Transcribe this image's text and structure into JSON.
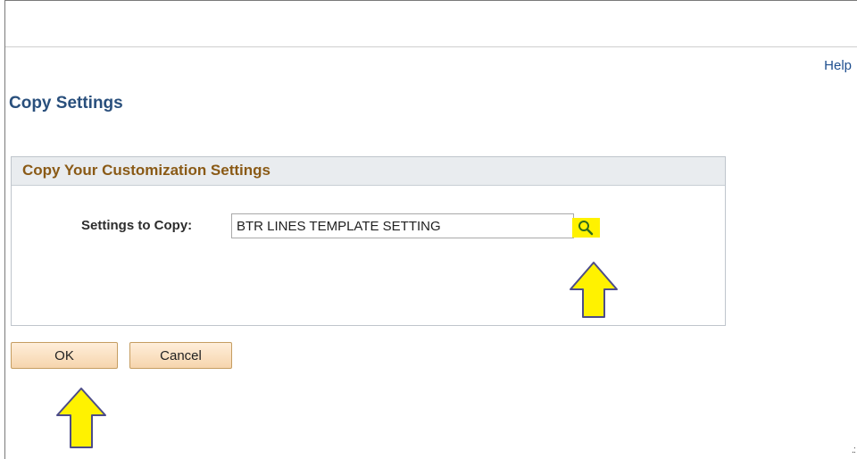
{
  "header": {
    "help_label": "Help"
  },
  "page": {
    "title": "Copy Settings"
  },
  "group": {
    "title": "Copy Your Customization Settings",
    "field_label": "Settings to Copy:",
    "field_value": "BTR LINES TEMPLATE SETTING"
  },
  "buttons": {
    "ok_label": "OK",
    "cancel_label": "Cancel"
  },
  "icons": {
    "lookup": "magnifier-lookup-icon",
    "annotation": "up-arrow-icon",
    "resize": "resize-grip-icon"
  },
  "colors": {
    "title": "#294f7c",
    "group_title": "#8a5a16",
    "help_link": "#1f4f8f",
    "button_face": "#f6d5ad",
    "highlight": "#fff200"
  }
}
